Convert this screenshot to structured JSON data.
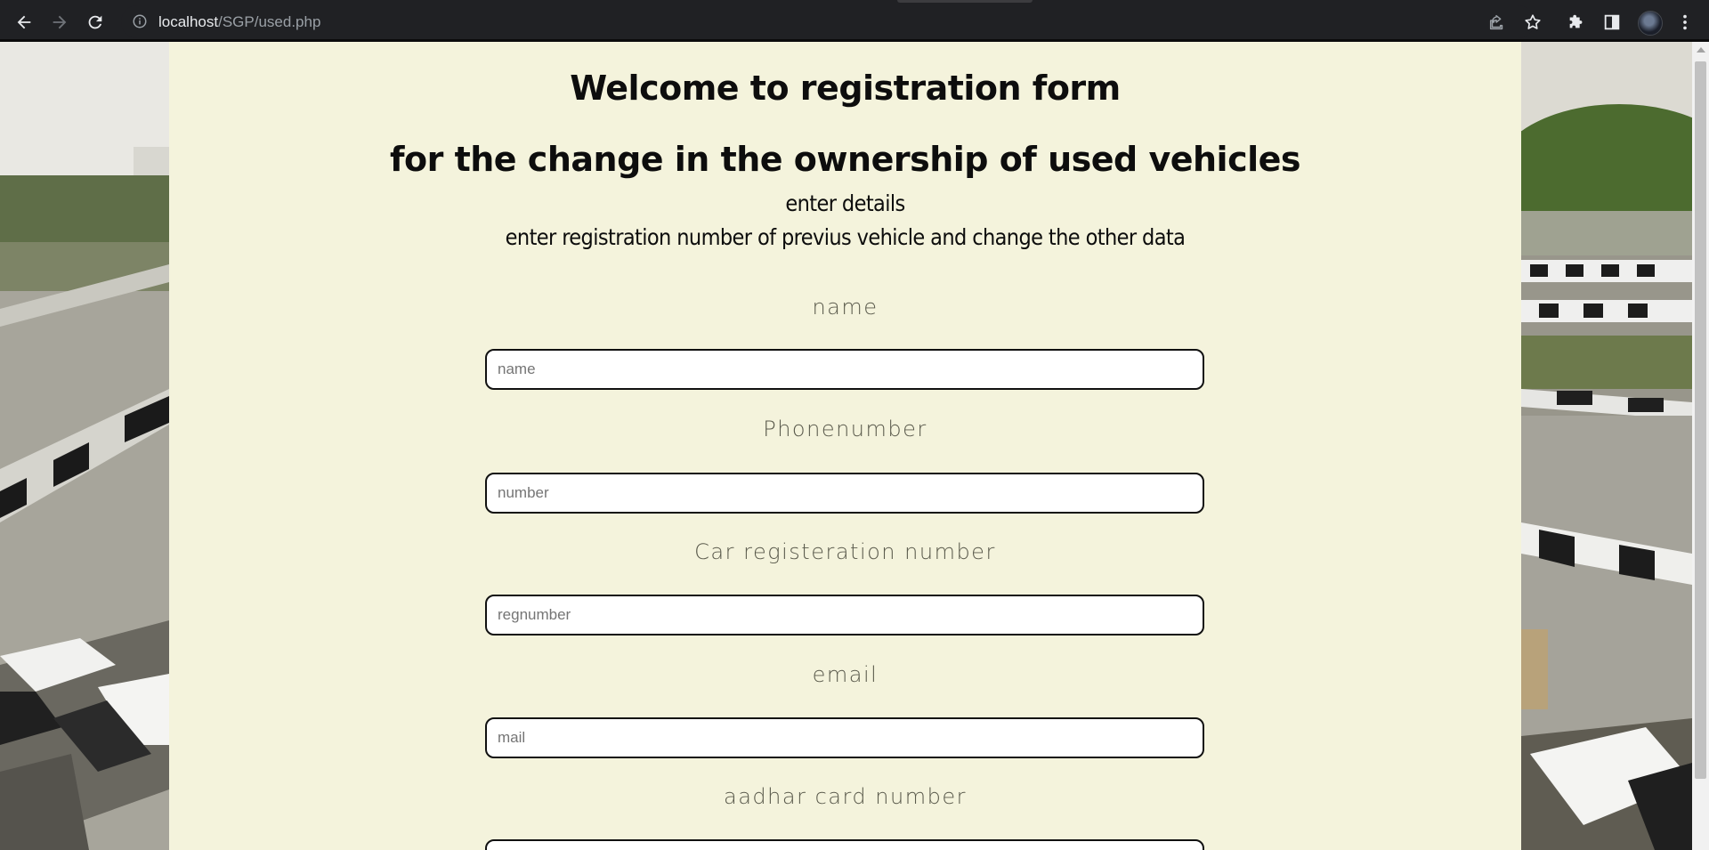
{
  "browser": {
    "url_host": "localhost",
    "url_path": "/SGP/used.php",
    "icons": [
      "back-icon",
      "forward-icon",
      "reload-icon",
      "site-info-icon",
      "share-icon",
      "bookmark-star-icon",
      "extensions-icon",
      "side-panel-icon",
      "profile-avatar",
      "menu-icon"
    ]
  },
  "page": {
    "heading1": "Welcome to registration form",
    "heading2": "for the change in the ownership of used vehicles",
    "sub1": "enter details",
    "sub2": "enter registration number of previus vehicle and change the other data"
  },
  "form": {
    "name": {
      "label": "name",
      "placeholder": "name",
      "value": ""
    },
    "phone": {
      "label": "Phonenumber",
      "placeholder": "number",
      "value": ""
    },
    "regnumber": {
      "label": "Car registeration number",
      "placeholder": "regnumber",
      "value": ""
    },
    "email": {
      "label": "email",
      "placeholder": "mail",
      "value": ""
    },
    "aadhar": {
      "label": "aadhar card number",
      "placeholder": "",
      "value": ""
    }
  },
  "colors": {
    "panel_bg": "#f4f3dc",
    "label_color": "#5a5a4c",
    "chrome_bg": "#202124"
  }
}
